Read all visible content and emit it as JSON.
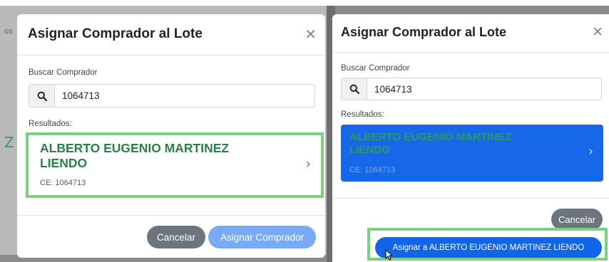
{
  "left_modal": {
    "title": "Asignar Comprador al Lote",
    "close_glyph": "✕",
    "search_label": "Buscar Comprador",
    "search_value": "1064713",
    "results_label": "Resultados:",
    "result": {
      "name": "ALBERTO EUGENIO MARTINEZ LIENDO",
      "ce": "CE: 1064713",
      "chevron": "›"
    },
    "cancel_label": "Cancelar",
    "assign_label": "Asignar Comprador"
  },
  "right_modal": {
    "title": "Asignar Comprador al Lote",
    "close_glyph": "✕",
    "search_label": "Buscar Comprador",
    "search_value": "1064713",
    "results_label": "Resultados:",
    "result": {
      "name": "ALBERTO EUGENIO MARTINEZ LIENDO",
      "ce": "CE: 1064713",
      "chevron": "›"
    },
    "cancel_label": "Cancelar",
    "assign_label": "Asignar a ALBERTO EUGENIO MARTINEZ LIENDO"
  },
  "background": {
    "frag_gs": "GS",
    "frag_z": "Z"
  },
  "colors": {
    "highlight_outline": "#79d27f",
    "primary": "#1166e8",
    "secondary": "#6c757d",
    "result_name_green": "#2a7f4a"
  }
}
